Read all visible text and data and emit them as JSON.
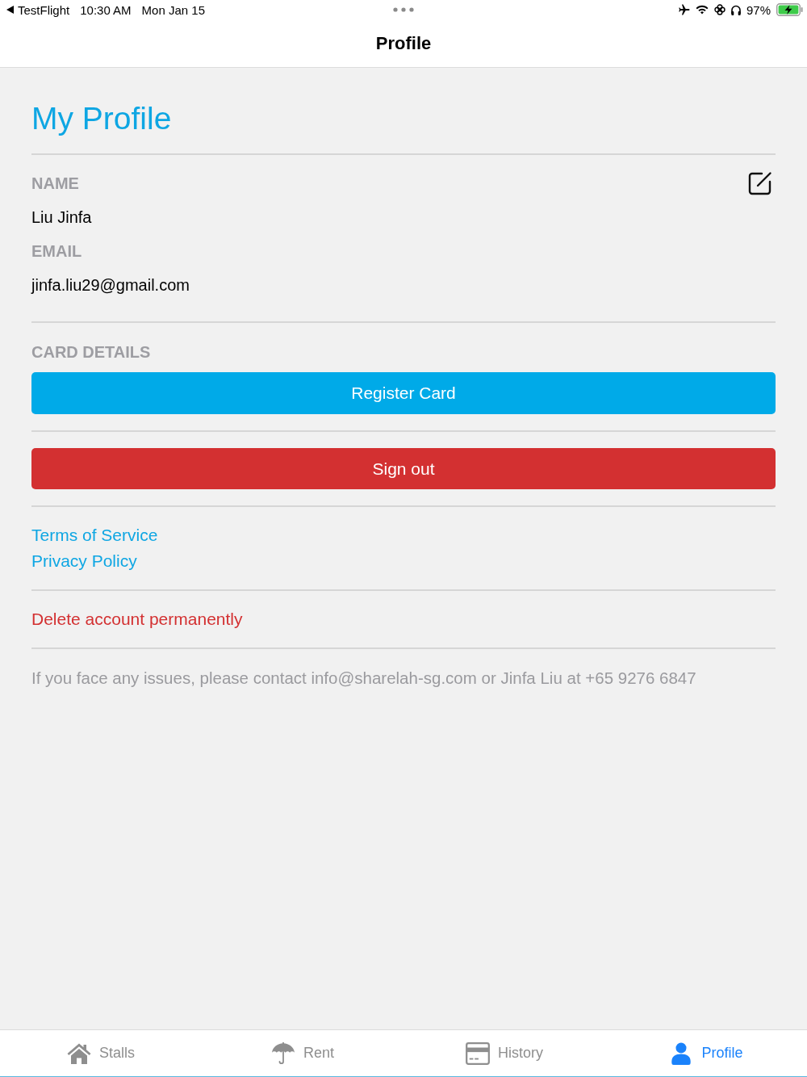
{
  "status_bar": {
    "back_app": "TestFlight",
    "time": "10:30 AM",
    "date": "Mon Jan 15",
    "battery": "97%"
  },
  "nav_bar": {
    "title": "Profile"
  },
  "profile": {
    "heading": "My Profile",
    "fields": [
      {
        "label": "NAME",
        "value": "Liu Jinfa"
      },
      {
        "label": "EMAIL",
        "value": "jinfa.liu29@gmail.com"
      }
    ],
    "card_section": {
      "label": "CARD DETAILS",
      "button": "Register Card"
    },
    "sign_out_button": "Sign out",
    "links": [
      "Terms of Service",
      "Privacy Policy"
    ],
    "delete_link": "Delete account permanently",
    "footer": "If you face any issues, please contact info@sharelah-sg.com or Jinfa Liu at +65 9276 6847"
  },
  "tab_bar": {
    "tabs": [
      {
        "label": "Stalls",
        "selected": false
      },
      {
        "label": "Rent",
        "selected": false
      },
      {
        "label": "History",
        "selected": false
      },
      {
        "label": "Profile",
        "selected": true
      }
    ]
  }
}
